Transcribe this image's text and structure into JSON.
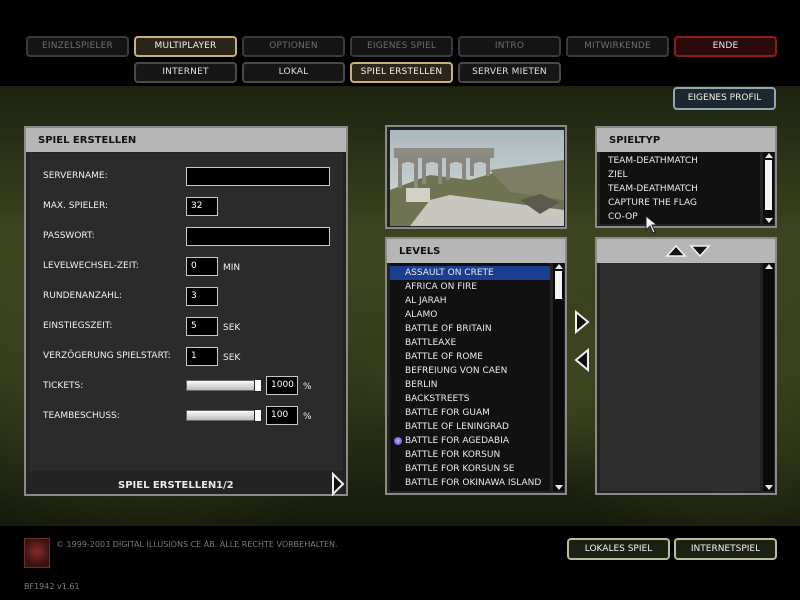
{
  "main_nav": [
    "EINZELSPIELER",
    "MULTIPLAYER",
    "OPTIONEN",
    "EIGENES SPIEL",
    "INTRO",
    "MITWIRKENDE",
    "ENDE"
  ],
  "sub_nav": [
    "INTERNET",
    "LOKAL",
    "SPIEL ERSTELLEN",
    "SERVER MIETEN"
  ],
  "profile_button": "EIGENES PROFIL",
  "create_panel": {
    "title": "SPIEL ERSTELLEN",
    "fields": {
      "servername": {
        "label": "SERVERNAME:",
        "value": ""
      },
      "max_players": {
        "label": "MAX. SPIELER:",
        "value": "32"
      },
      "password": {
        "label": "PASSWORT:",
        "value": ""
      },
      "level_change": {
        "label": "LEVELWECHSEL-ZEIT:",
        "value": "0",
        "unit": "MIN"
      },
      "rounds": {
        "label": "RUNDENANZAHL:",
        "value": "3"
      },
      "spawn_time": {
        "label": "EINSTIEGSZEIT:",
        "value": "5",
        "unit": "SEK"
      },
      "start_delay": {
        "label": "VERZÖGERUNG SPIELSTART:",
        "value": "1",
        "unit": "SEK"
      },
      "tickets": {
        "label": "TICKETS:",
        "value": "1000",
        "unit": "%",
        "level": 1.0
      },
      "team_damage": {
        "label": "TEAMBESCHUSS:",
        "value": "100",
        "unit": "%",
        "level": 1.0
      }
    },
    "footer": "SPIEL ERSTELLEN",
    "page": "1/2"
  },
  "game_type": {
    "title": "SPIELTYP",
    "items": [
      "TEAM-DEATHMATCH",
      "ZIEL",
      "TEAM-DEATHMATCH",
      "CAPTURE THE FLAG",
      "CO-OP"
    ]
  },
  "levels": {
    "title": "LEVELS",
    "items": [
      "ASSAULT ON CRETE",
      "AFRICA ON FIRE",
      "AL JARAH",
      "ALAMO",
      "BATTLE OF BRITAIN",
      "BATTLEAXE",
      "BATTLE OF ROME",
      "BEFREIUNG VON CAEN",
      "BERLIN",
      "BACKSTREETS",
      "BATTLE FOR GUAM",
      "BATTLE OF LENINGRAD",
      "BATTLE FOR AGEDABIA",
      "BATTLE FOR KORSUN",
      "BATTLE FOR KORSUN SE",
      "BATTLE FOR OKINAWA ISLAND"
    ]
  },
  "footer_buttons": [
    "LOKALES SPIEL",
    "INTERNETSPIEL"
  ],
  "copyright": "© 1999-2003 DIGITAL ILLUSIONS CE AB. ALLE RECHTE VORBEHALTEN.",
  "version": "BF1942 v1.61",
  "colors": {
    "accent": "#c8b27a",
    "selection": "#1b3e8e",
    "end_border": "#8d1c1c"
  }
}
